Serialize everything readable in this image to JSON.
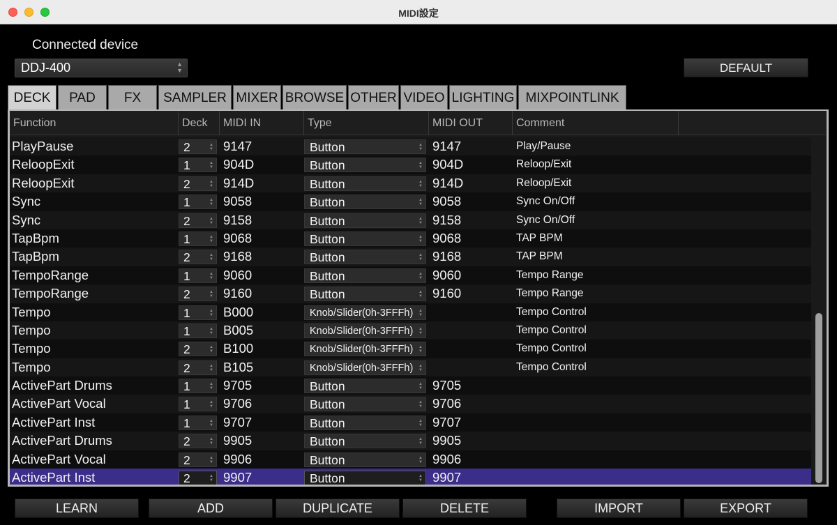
{
  "window": {
    "title": "MIDI設定"
  },
  "device": {
    "label": "Connected device",
    "selected": "DDJ-400"
  },
  "default_label": "DEFAULT",
  "tabs": [
    {
      "label": "DECK",
      "active": true
    },
    {
      "label": "PAD",
      "active": false
    },
    {
      "label": "FX",
      "active": false
    },
    {
      "label": "SAMPLER",
      "active": false
    },
    {
      "label": "MIXER",
      "active": false
    },
    {
      "label": "BROWSE",
      "active": false
    },
    {
      "label": "OTHER",
      "active": false
    },
    {
      "label": "VIDEO",
      "active": false
    },
    {
      "label": "LIGHTING",
      "active": false
    },
    {
      "label": "MIXPOINTLINK",
      "active": false
    }
  ],
  "columns": [
    "Function",
    "Deck",
    "MIDI IN",
    "Type",
    "MIDI OUT",
    "Comment"
  ],
  "rows": [
    {
      "function": "PlayPause",
      "deck": "2",
      "midi_in": "9147",
      "type": "Button",
      "midi_out": "9147",
      "comment": "Play/Pause",
      "selected": false
    },
    {
      "function": "ReloopExit",
      "deck": "1",
      "midi_in": "904D",
      "type": "Button",
      "midi_out": "904D",
      "comment": "Reloop/Exit",
      "selected": false
    },
    {
      "function": "ReloopExit",
      "deck": "2",
      "midi_in": "914D",
      "type": "Button",
      "midi_out": "914D",
      "comment": "Reloop/Exit",
      "selected": false
    },
    {
      "function": "Sync",
      "deck": "1",
      "midi_in": "9058",
      "type": "Button",
      "midi_out": "9058",
      "comment": "Sync On/Off",
      "selected": false
    },
    {
      "function": "Sync",
      "deck": "2",
      "midi_in": "9158",
      "type": "Button",
      "midi_out": "9158",
      "comment": "Sync On/Off",
      "selected": false
    },
    {
      "function": "TapBpm",
      "deck": "1",
      "midi_in": "9068",
      "type": "Button",
      "midi_out": "9068",
      "comment": "TAP BPM",
      "selected": false
    },
    {
      "function": "TapBpm",
      "deck": "2",
      "midi_in": "9168",
      "type": "Button",
      "midi_out": "9168",
      "comment": "TAP BPM",
      "selected": false
    },
    {
      "function": "TempoRange",
      "deck": "1",
      "midi_in": "9060",
      "type": "Button",
      "midi_out": "9060",
      "comment": "Tempo Range",
      "selected": false
    },
    {
      "function": "TempoRange",
      "deck": "2",
      "midi_in": "9160",
      "type": "Button",
      "midi_out": "9160",
      "comment": "Tempo Range",
      "selected": false
    },
    {
      "function": "Tempo",
      "deck": "1",
      "midi_in": "B000",
      "type": "Knob/Slider(0h-3FFFh)",
      "midi_out": "",
      "comment": "Tempo Control",
      "selected": false
    },
    {
      "function": "Tempo",
      "deck": "1",
      "midi_in": "B005",
      "type": "Knob/Slider(0h-3FFFh)",
      "midi_out": "",
      "comment": "Tempo Control",
      "selected": false
    },
    {
      "function": "Tempo",
      "deck": "2",
      "midi_in": "B100",
      "type": "Knob/Slider(0h-3FFFh)",
      "midi_out": "",
      "comment": "Tempo Control",
      "selected": false
    },
    {
      "function": "Tempo",
      "deck": "2",
      "midi_in": "B105",
      "type": "Knob/Slider(0h-3FFFh)",
      "midi_out": "",
      "comment": "Tempo Control",
      "selected": false
    },
    {
      "function": "ActivePart Drums",
      "deck": "1",
      "midi_in": "9705",
      "type": "Button",
      "midi_out": "9705",
      "comment": "",
      "selected": false
    },
    {
      "function": "ActivePart Vocal",
      "deck": "1",
      "midi_in": "9706",
      "type": "Button",
      "midi_out": "9706",
      "comment": "",
      "selected": false
    },
    {
      "function": "ActivePart Inst",
      "deck": "1",
      "midi_in": "9707",
      "type": "Button",
      "midi_out": "9707",
      "comment": "",
      "selected": false
    },
    {
      "function": "ActivePart Drums",
      "deck": "2",
      "midi_in": "9905",
      "type": "Button",
      "midi_out": "9905",
      "comment": "",
      "selected": false
    },
    {
      "function": "ActivePart Vocal",
      "deck": "2",
      "midi_in": "9906",
      "type": "Button",
      "midi_out": "9906",
      "comment": "",
      "selected": false
    },
    {
      "function": "ActivePart Inst",
      "deck": "2",
      "midi_in": "9907",
      "type": "Button",
      "midi_out": "9907",
      "comment": "",
      "selected": true
    }
  ],
  "scrollbar": {
    "position_fraction": 0.5
  },
  "buttons": {
    "learn": "LEARN",
    "add": "ADD",
    "duplicate": "DUPLICATE",
    "delete": "DELETE",
    "import": "IMPORT",
    "export": "EXPORT"
  },
  "colors": {
    "background": "#000000",
    "selected_row": "#3b2d8a",
    "active_tab": "#d2d2d2",
    "inactive_tab": "#a9a9a9"
  }
}
